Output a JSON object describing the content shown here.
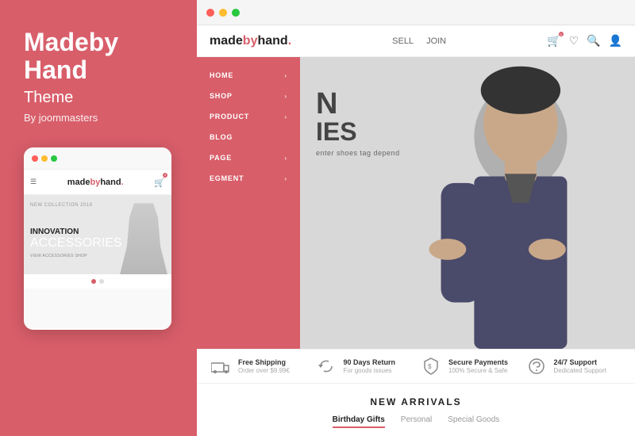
{
  "left_panel": {
    "brand_title": "Madeby Hand",
    "brand_subtitle": "Theme",
    "brand_author": "By joommasters"
  },
  "phone_mockup": {
    "dots": [
      "red",
      "yellow",
      "green"
    ],
    "logo_text": "made",
    "logo_by": "by",
    "logo_hand": "hand",
    "nav_hero_label": "NEW COLLECTION 2018",
    "hero_headline_1": "INNOVATION",
    "hero_headline_2": "ACCESSORIES",
    "hero_cta": "VIEW ACCESSORIES SHOP"
  },
  "browser": {
    "dots": [
      "red",
      "yellow",
      "green"
    ]
  },
  "site_nav": {
    "logo_made": "made",
    "logo_by": "by",
    "logo_hand": "hand.",
    "links": [
      "SELL",
      "JOIN"
    ],
    "icons": [
      "cart",
      "heart",
      "search",
      "user"
    ]
  },
  "sidebar_menu": {
    "items": [
      {
        "label": "HOME",
        "has_arrow": true
      },
      {
        "label": "SHOP",
        "has_arrow": true
      },
      {
        "label": "PRODUCT",
        "has_arrow": true
      },
      {
        "label": "BLOG",
        "has_arrow": false
      },
      {
        "label": "PAGE",
        "has_arrow": true
      },
      {
        "label": "EGMENT",
        "has_arrow": true
      }
    ]
  },
  "hero": {
    "big_letter_1": "N",
    "big_text": "IES",
    "subtext": "enter shoes tag depend"
  },
  "features": [
    {
      "icon": "truck",
      "title": "Free Shipping",
      "desc": "Order over $9.99€"
    },
    {
      "icon": "return",
      "title": "90 Days Return",
      "desc": "For goods issues"
    },
    {
      "icon": "shield",
      "title": "Secure Payments",
      "desc": "100% Secure & Safe"
    },
    {
      "icon": "support",
      "title": "24/7 Support",
      "desc": "Dedicated Support"
    }
  ],
  "new_arrivals": {
    "title": "NEW ARRIVALS",
    "tabs": [
      {
        "label": "Birthday Gifts",
        "active": true
      },
      {
        "label": "Personal",
        "active": false
      },
      {
        "label": "Special Goods",
        "active": false
      }
    ]
  }
}
